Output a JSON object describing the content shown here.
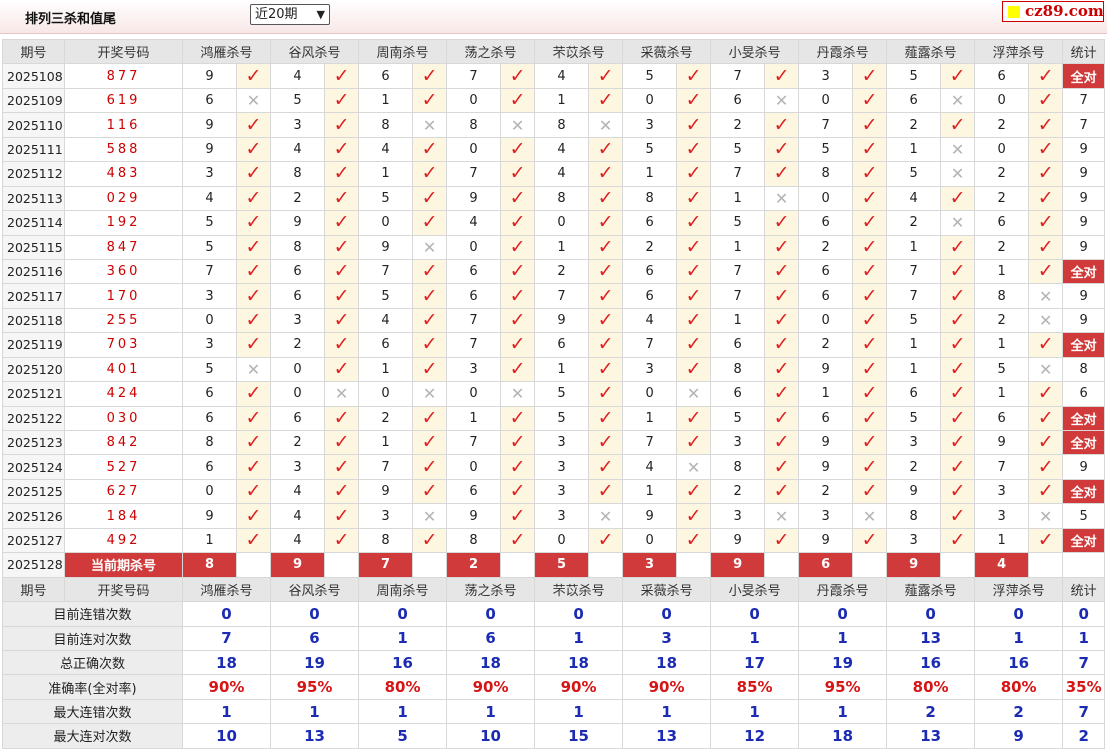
{
  "header": {
    "title": "排列三杀和值尾",
    "select_value": "近20期",
    "logo": "cz89.com"
  },
  "columns": {
    "period": "期号",
    "draw": "开奖号码",
    "experts": [
      "鸿雁杀号",
      "谷风杀号",
      "周南杀号",
      "荡之杀号",
      "芣苡杀号",
      "采薇杀号",
      "小旻杀号",
      "丹霞杀号",
      "薤露杀号",
      "浮萍杀号"
    ],
    "stats": "统计"
  },
  "rows": [
    {
      "period": "2025108",
      "draw": "877",
      "picks": [
        {
          "n": "9",
          "ok": true
        },
        {
          "n": "4",
          "ok": true
        },
        {
          "n": "6",
          "ok": true
        },
        {
          "n": "7",
          "ok": true
        },
        {
          "n": "4",
          "ok": true
        },
        {
          "n": "5",
          "ok": true
        },
        {
          "n": "7",
          "ok": true
        },
        {
          "n": "3",
          "ok": true
        },
        {
          "n": "5",
          "ok": true
        },
        {
          "n": "6",
          "ok": true
        }
      ],
      "stat": "全对",
      "all_ok": true
    },
    {
      "period": "2025109",
      "draw": "619",
      "picks": [
        {
          "n": "6",
          "ok": false
        },
        {
          "n": "5",
          "ok": true
        },
        {
          "n": "1",
          "ok": true
        },
        {
          "n": "0",
          "ok": true
        },
        {
          "n": "1",
          "ok": true
        },
        {
          "n": "0",
          "ok": true
        },
        {
          "n": "6",
          "ok": false
        },
        {
          "n": "0",
          "ok": true
        },
        {
          "n": "6",
          "ok": false
        },
        {
          "n": "0",
          "ok": true
        }
      ],
      "stat": "7",
      "all_ok": false
    },
    {
      "period": "2025110",
      "draw": "116",
      "picks": [
        {
          "n": "9",
          "ok": true
        },
        {
          "n": "3",
          "ok": true
        },
        {
          "n": "8",
          "ok": false
        },
        {
          "n": "8",
          "ok": false
        },
        {
          "n": "8",
          "ok": false
        },
        {
          "n": "3",
          "ok": true
        },
        {
          "n": "2",
          "ok": true
        },
        {
          "n": "7",
          "ok": true
        },
        {
          "n": "2",
          "ok": true
        },
        {
          "n": "2",
          "ok": true
        }
      ],
      "stat": "7",
      "all_ok": false
    },
    {
      "period": "2025111",
      "draw": "588",
      "picks": [
        {
          "n": "9",
          "ok": true
        },
        {
          "n": "4",
          "ok": true
        },
        {
          "n": "4",
          "ok": true
        },
        {
          "n": "0",
          "ok": true
        },
        {
          "n": "4",
          "ok": true
        },
        {
          "n": "5",
          "ok": true
        },
        {
          "n": "5",
          "ok": true
        },
        {
          "n": "5",
          "ok": true
        },
        {
          "n": "1",
          "ok": false
        },
        {
          "n": "0",
          "ok": true
        }
      ],
      "stat": "9",
      "all_ok": false
    },
    {
      "period": "2025112",
      "draw": "483",
      "picks": [
        {
          "n": "3",
          "ok": true
        },
        {
          "n": "8",
          "ok": true
        },
        {
          "n": "1",
          "ok": true
        },
        {
          "n": "7",
          "ok": true
        },
        {
          "n": "4",
          "ok": true
        },
        {
          "n": "1",
          "ok": true
        },
        {
          "n": "7",
          "ok": true
        },
        {
          "n": "8",
          "ok": true
        },
        {
          "n": "5",
          "ok": false
        },
        {
          "n": "2",
          "ok": true
        }
      ],
      "stat": "9",
      "all_ok": false
    },
    {
      "period": "2025113",
      "draw": "029",
      "picks": [
        {
          "n": "4",
          "ok": true
        },
        {
          "n": "2",
          "ok": true
        },
        {
          "n": "5",
          "ok": true
        },
        {
          "n": "9",
          "ok": true
        },
        {
          "n": "8",
          "ok": true
        },
        {
          "n": "8",
          "ok": true
        },
        {
          "n": "1",
          "ok": false
        },
        {
          "n": "0",
          "ok": true
        },
        {
          "n": "4",
          "ok": true
        },
        {
          "n": "2",
          "ok": true
        }
      ],
      "stat": "9",
      "all_ok": false
    },
    {
      "period": "2025114",
      "draw": "192",
      "picks": [
        {
          "n": "5",
          "ok": true
        },
        {
          "n": "9",
          "ok": true
        },
        {
          "n": "0",
          "ok": true
        },
        {
          "n": "4",
          "ok": true
        },
        {
          "n": "0",
          "ok": true
        },
        {
          "n": "6",
          "ok": true
        },
        {
          "n": "5",
          "ok": true
        },
        {
          "n": "6",
          "ok": true
        },
        {
          "n": "2",
          "ok": false
        },
        {
          "n": "6",
          "ok": true
        }
      ],
      "stat": "9",
      "all_ok": false
    },
    {
      "period": "2025115",
      "draw": "847",
      "picks": [
        {
          "n": "5",
          "ok": true
        },
        {
          "n": "8",
          "ok": true
        },
        {
          "n": "9",
          "ok": false
        },
        {
          "n": "0",
          "ok": true
        },
        {
          "n": "1",
          "ok": true
        },
        {
          "n": "2",
          "ok": true
        },
        {
          "n": "1",
          "ok": true
        },
        {
          "n": "2",
          "ok": true
        },
        {
          "n": "1",
          "ok": true
        },
        {
          "n": "2",
          "ok": true
        }
      ],
      "stat": "9",
      "all_ok": false
    },
    {
      "period": "2025116",
      "draw": "360",
      "picks": [
        {
          "n": "7",
          "ok": true
        },
        {
          "n": "6",
          "ok": true
        },
        {
          "n": "7",
          "ok": true
        },
        {
          "n": "6",
          "ok": true
        },
        {
          "n": "2",
          "ok": true
        },
        {
          "n": "6",
          "ok": true
        },
        {
          "n": "7",
          "ok": true
        },
        {
          "n": "6",
          "ok": true
        },
        {
          "n": "7",
          "ok": true
        },
        {
          "n": "1",
          "ok": true
        }
      ],
      "stat": "全对",
      "all_ok": true
    },
    {
      "period": "2025117",
      "draw": "170",
      "picks": [
        {
          "n": "3",
          "ok": true
        },
        {
          "n": "6",
          "ok": true
        },
        {
          "n": "5",
          "ok": true
        },
        {
          "n": "6",
          "ok": true
        },
        {
          "n": "7",
          "ok": true
        },
        {
          "n": "6",
          "ok": true
        },
        {
          "n": "7",
          "ok": true
        },
        {
          "n": "6",
          "ok": true
        },
        {
          "n": "7",
          "ok": true
        },
        {
          "n": "8",
          "ok": false
        }
      ],
      "stat": "9",
      "all_ok": false
    },
    {
      "period": "2025118",
      "draw": "255",
      "picks": [
        {
          "n": "0",
          "ok": true
        },
        {
          "n": "3",
          "ok": true
        },
        {
          "n": "4",
          "ok": true
        },
        {
          "n": "7",
          "ok": true
        },
        {
          "n": "9",
          "ok": true
        },
        {
          "n": "4",
          "ok": true
        },
        {
          "n": "1",
          "ok": true
        },
        {
          "n": "0",
          "ok": true
        },
        {
          "n": "5",
          "ok": true
        },
        {
          "n": "2",
          "ok": false
        }
      ],
      "stat": "9",
      "all_ok": false
    },
    {
      "period": "2025119",
      "draw": "703",
      "picks": [
        {
          "n": "3",
          "ok": true
        },
        {
          "n": "2",
          "ok": true
        },
        {
          "n": "6",
          "ok": true
        },
        {
          "n": "7",
          "ok": true
        },
        {
          "n": "6",
          "ok": true
        },
        {
          "n": "7",
          "ok": true
        },
        {
          "n": "6",
          "ok": true
        },
        {
          "n": "2",
          "ok": true
        },
        {
          "n": "1",
          "ok": true
        },
        {
          "n": "1",
          "ok": true
        }
      ],
      "stat": "全对",
      "all_ok": true
    },
    {
      "period": "2025120",
      "draw": "401",
      "picks": [
        {
          "n": "5",
          "ok": false
        },
        {
          "n": "0",
          "ok": true
        },
        {
          "n": "1",
          "ok": true
        },
        {
          "n": "3",
          "ok": true
        },
        {
          "n": "1",
          "ok": true
        },
        {
          "n": "3",
          "ok": true
        },
        {
          "n": "8",
          "ok": true
        },
        {
          "n": "9",
          "ok": true
        },
        {
          "n": "1",
          "ok": true
        },
        {
          "n": "5",
          "ok": false
        }
      ],
      "stat": "8",
      "all_ok": false
    },
    {
      "period": "2025121",
      "draw": "424",
      "picks": [
        {
          "n": "6",
          "ok": true
        },
        {
          "n": "0",
          "ok": false
        },
        {
          "n": "0",
          "ok": false
        },
        {
          "n": "0",
          "ok": false
        },
        {
          "n": "5",
          "ok": true
        },
        {
          "n": "0",
          "ok": false
        },
        {
          "n": "6",
          "ok": true
        },
        {
          "n": "1",
          "ok": true
        },
        {
          "n": "6",
          "ok": true
        },
        {
          "n": "1",
          "ok": true
        }
      ],
      "stat": "6",
      "all_ok": false
    },
    {
      "period": "2025122",
      "draw": "030",
      "picks": [
        {
          "n": "6",
          "ok": true
        },
        {
          "n": "6",
          "ok": true
        },
        {
          "n": "2",
          "ok": true
        },
        {
          "n": "1",
          "ok": true
        },
        {
          "n": "5",
          "ok": true
        },
        {
          "n": "1",
          "ok": true
        },
        {
          "n": "5",
          "ok": true
        },
        {
          "n": "6",
          "ok": true
        },
        {
          "n": "5",
          "ok": true
        },
        {
          "n": "6",
          "ok": true
        }
      ],
      "stat": "全对",
      "all_ok": true
    },
    {
      "period": "2025123",
      "draw": "842",
      "picks": [
        {
          "n": "8",
          "ok": true
        },
        {
          "n": "2",
          "ok": true
        },
        {
          "n": "1",
          "ok": true
        },
        {
          "n": "7",
          "ok": true
        },
        {
          "n": "3",
          "ok": true
        },
        {
          "n": "7",
          "ok": true
        },
        {
          "n": "3",
          "ok": true
        },
        {
          "n": "9",
          "ok": true
        },
        {
          "n": "3",
          "ok": true
        },
        {
          "n": "9",
          "ok": true
        }
      ],
      "stat": "全对",
      "all_ok": true
    },
    {
      "period": "2025124",
      "draw": "527",
      "picks": [
        {
          "n": "6",
          "ok": true
        },
        {
          "n": "3",
          "ok": true
        },
        {
          "n": "7",
          "ok": true
        },
        {
          "n": "0",
          "ok": true
        },
        {
          "n": "3",
          "ok": true
        },
        {
          "n": "4",
          "ok": false
        },
        {
          "n": "8",
          "ok": true
        },
        {
          "n": "9",
          "ok": true
        },
        {
          "n": "2",
          "ok": true
        },
        {
          "n": "7",
          "ok": true
        }
      ],
      "stat": "9",
      "all_ok": false
    },
    {
      "period": "2025125",
      "draw": "627",
      "picks": [
        {
          "n": "0",
          "ok": true
        },
        {
          "n": "4",
          "ok": true
        },
        {
          "n": "9",
          "ok": true
        },
        {
          "n": "6",
          "ok": true
        },
        {
          "n": "3",
          "ok": true
        },
        {
          "n": "1",
          "ok": true
        },
        {
          "n": "2",
          "ok": true
        },
        {
          "n": "2",
          "ok": true
        },
        {
          "n": "9",
          "ok": true
        },
        {
          "n": "3",
          "ok": true
        }
      ],
      "stat": "全对",
      "all_ok": true
    },
    {
      "period": "2025126",
      "draw": "184",
      "picks": [
        {
          "n": "9",
          "ok": true
        },
        {
          "n": "4",
          "ok": true
        },
        {
          "n": "3",
          "ok": false
        },
        {
          "n": "9",
          "ok": true
        },
        {
          "n": "3",
          "ok": false
        },
        {
          "n": "9",
          "ok": true
        },
        {
          "n": "3",
          "ok": false
        },
        {
          "n": "3",
          "ok": false
        },
        {
          "n": "8",
          "ok": true
        },
        {
          "n": "3",
          "ok": false
        }
      ],
      "stat": "5",
      "all_ok": false
    },
    {
      "period": "2025127",
      "draw": "492",
      "picks": [
        {
          "n": "1",
          "ok": true
        },
        {
          "n": "4",
          "ok": true
        },
        {
          "n": "8",
          "ok": true
        },
        {
          "n": "8",
          "ok": true
        },
        {
          "n": "0",
          "ok": true
        },
        {
          "n": "0",
          "ok": true
        },
        {
          "n": "9",
          "ok": true
        },
        {
          "n": "9",
          "ok": true
        },
        {
          "n": "3",
          "ok": true
        },
        {
          "n": "1",
          "ok": true
        }
      ],
      "stat": "全对",
      "all_ok": true
    }
  ],
  "current": {
    "period": "2025128",
    "label": "当前期杀号",
    "picks": [
      "8",
      "9",
      "7",
      "2",
      "5",
      "3",
      "9",
      "6",
      "9",
      "4"
    ]
  },
  "stats_rows": [
    {
      "label": "目前连错次数",
      "values": [
        "0",
        "0",
        "0",
        "0",
        "0",
        "0",
        "0",
        "0",
        "0",
        "0",
        "0"
      ],
      "style": "blue"
    },
    {
      "label": "目前连对次数",
      "values": [
        "7",
        "6",
        "1",
        "6",
        "1",
        "3",
        "1",
        "1",
        "13",
        "1",
        "1"
      ],
      "style": "blue"
    },
    {
      "label": "总正确次数",
      "values": [
        "18",
        "19",
        "16",
        "18",
        "18",
        "18",
        "17",
        "19",
        "16",
        "16",
        "7"
      ],
      "style": "blue"
    },
    {
      "label": "准确率(全对率)",
      "values": [
        "90%",
        "95%",
        "80%",
        "90%",
        "90%",
        "90%",
        "85%",
        "95%",
        "80%",
        "80%",
        "35%"
      ],
      "style": "red"
    },
    {
      "label": "最大连错次数",
      "values": [
        "1",
        "1",
        "1",
        "1",
        "1",
        "1",
        "1",
        "1",
        "2",
        "2",
        "7"
      ],
      "style": "blue"
    },
    {
      "label": "最大连对次数",
      "values": [
        "10",
        "13",
        "5",
        "10",
        "15",
        "13",
        "12",
        "18",
        "13",
        "9",
        "2"
      ],
      "style": "blue"
    }
  ],
  "icons": {
    "ok": "check-icon",
    "ng": "cross-icon"
  },
  "colors": {
    "accent": "#d13a3a",
    "draw_number": "#cc0000",
    "stat_blue": "#1b2bb3",
    "mark_bg": "#fdf7e2"
  }
}
